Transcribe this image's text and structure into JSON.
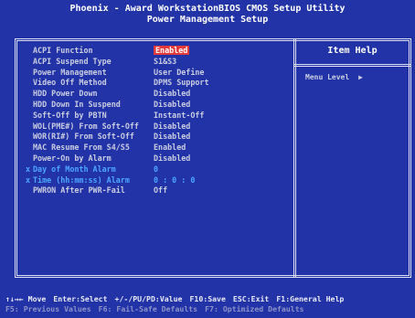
{
  "header": {
    "line1": "Phoenix - Award WorkstationBIOS CMOS Setup Utility",
    "line2": "Power Management Setup"
  },
  "help": {
    "title": "Item Help",
    "menu_level": "Menu Level",
    "arrow": "▶"
  },
  "settings": [
    {
      "marker": "",
      "label": "ACPI Function",
      "value": "Enabled",
      "selected": true,
      "greyed": false
    },
    {
      "marker": "",
      "label": "ACPI Suspend Type",
      "value": "S1&S3",
      "selected": false,
      "greyed": false
    },
    {
      "marker": "",
      "label": "Power Management",
      "value": "User Define",
      "selected": false,
      "greyed": false
    },
    {
      "marker": "",
      "label": "Video Off Method",
      "value": "DPMS Support",
      "selected": false,
      "greyed": false
    },
    {
      "marker": "",
      "label": "HDD Power Down",
      "value": "Disabled",
      "selected": false,
      "greyed": false
    },
    {
      "marker": "",
      "label": "HDD Down In Suspend",
      "value": "Disabled",
      "selected": false,
      "greyed": false
    },
    {
      "marker": "",
      "label": "Soft-Off by PBTN",
      "value": "Instant-Off",
      "selected": false,
      "greyed": false
    },
    {
      "marker": "",
      "label": "WOL(PME#) From Soft-Off",
      "value": "Disabled",
      "selected": false,
      "greyed": false
    },
    {
      "marker": "",
      "label": "WOR(RI#) From Soft-Off",
      "value": "Disabled",
      "selected": false,
      "greyed": false
    },
    {
      "marker": "",
      "label": "MAC Resume From S4/S5",
      "value": "Enabled",
      "selected": false,
      "greyed": false
    },
    {
      "marker": "",
      "label": "Power-On by Alarm",
      "value": "Disabled",
      "selected": false,
      "greyed": false
    },
    {
      "marker": "x",
      "label": "Day of Month Alarm",
      "value": "0",
      "selected": false,
      "greyed": true
    },
    {
      "marker": "x",
      "label": "Time (hh:mm:ss) Alarm",
      "value": "0 : 0 : 0",
      "selected": false,
      "greyed": true
    },
    {
      "marker": "",
      "label": "PWRON After PWR-Fail",
      "value": "Off",
      "selected": false,
      "greyed": false
    }
  ],
  "footer": {
    "line1": [
      "↑↓→← Move",
      "Enter:Select",
      "+/-/PU/PD:Value",
      "F10:Save",
      "ESC:Exit",
      "F1:General Help"
    ],
    "line2": [
      "F5: Previous Values",
      "F6: Fail-Safe Defaults",
      "F7: Optimized Defaults"
    ]
  },
  "colors": {
    "background": "#2233a8",
    "text": "#c9cde0",
    "highlight": "#e63a3a",
    "greyed": "#4da6ff",
    "title": "#ffffff"
  }
}
